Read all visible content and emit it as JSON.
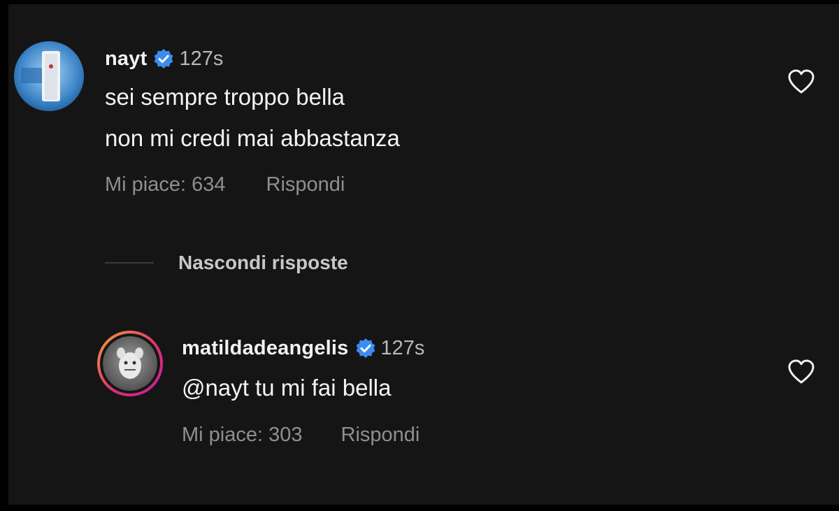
{
  "comment": {
    "username": "nayt",
    "time": "127s",
    "lines": [
      "sei sempre troppo bella",
      "non mi credi mai abbastanza"
    ],
    "likes_label": "Mi piace: 634",
    "reply_label": "Rispondi"
  },
  "replies_toggle": {
    "label": "Nascondi risposte"
  },
  "reply": {
    "username": "matildadeangelis",
    "time": "127s",
    "text": "@nayt tu mi fai bella",
    "likes_label": "Mi piace: 303",
    "reply_label": "Rispondi"
  },
  "icons": {
    "verified": "verified-badge-icon",
    "heart": "heart-outline-icon"
  },
  "colors": {
    "background": "#151516",
    "verified": "#3a8cf0",
    "story_ring_start": "#f4a339",
    "story_ring_end": "#c41da6"
  }
}
